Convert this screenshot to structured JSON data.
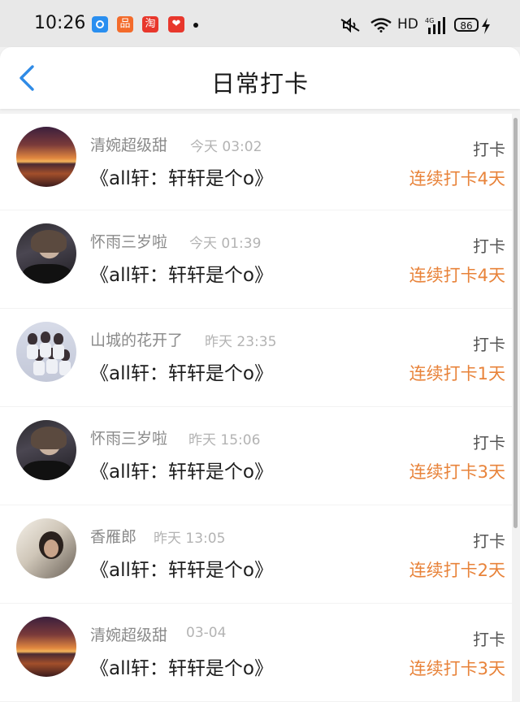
{
  "status_bar": {
    "time": "10:26",
    "apps": [
      "circle-app-icon",
      "orange-app-icon",
      "taobao-icon",
      "red-app-icon"
    ],
    "app_glyphs": [
      "",
      "品",
      "淘",
      "❤"
    ],
    "network_label": "HD",
    "signal_label": "4G",
    "battery": "86"
  },
  "header": {
    "title": "日常打卡"
  },
  "checkins": [
    {
      "name": "清婉超级甜",
      "time": "今天 03:02",
      "message": "《all轩：轩轩是个o》",
      "action": "打卡",
      "streak": "连续打卡4天",
      "avatar": "sunset"
    },
    {
      "name": "怀雨三岁啦",
      "time": "今天 01:39",
      "message": "《all轩：轩轩是个o》",
      "action": "打卡",
      "streak": "连续打卡4天",
      "avatar": "boy"
    },
    {
      "name": "山城的花开了",
      "time": "昨天 23:35",
      "message": "《all轩：轩轩是个o》",
      "action": "打卡",
      "streak": "连续打卡1天",
      "avatar": "group"
    },
    {
      "name": "怀雨三岁啦",
      "time": "昨天 15:06",
      "message": "《all轩：轩轩是个o》",
      "action": "打卡",
      "streak": "连续打卡3天",
      "avatar": "boy"
    },
    {
      "name": "香雁郎",
      "time": "昨天 13:05",
      "message": "《all轩：轩轩是个o》",
      "action": "打卡",
      "streak": "连续打卡2天",
      "avatar": "woman"
    },
    {
      "name": "清婉超级甜",
      "time": "03-04",
      "message": "《all轩：轩轩是个o》",
      "action": "打卡",
      "streak": "连续打卡3天",
      "avatar": "sunset"
    }
  ],
  "colors": {
    "accent": "#e8833a",
    "back": "#2f8be6"
  }
}
